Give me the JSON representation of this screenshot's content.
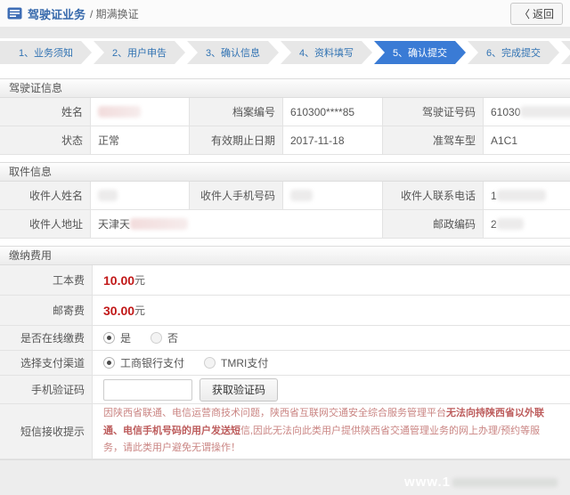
{
  "header": {
    "title": "驾驶证业务",
    "subtitle": "/ 期满换证",
    "back_chevron": "〈",
    "back_label": "返回"
  },
  "steps": [
    {
      "label": "1、业务须知",
      "active": false
    },
    {
      "label": "2、用户申告",
      "active": false
    },
    {
      "label": "3、确认信息",
      "active": false
    },
    {
      "label": "4、资料填写",
      "active": false
    },
    {
      "label": "5、确认提交",
      "active": true
    },
    {
      "label": "6、完成提交",
      "active": false
    }
  ],
  "license": {
    "title": "驾驶证信息",
    "name_label": "姓名",
    "file_no_label": "档案编号",
    "file_no_value": "610300****85",
    "license_no_label": "驾驶证号码",
    "license_no_value": "61030",
    "license_no_cut": "(",
    "status_label": "状态",
    "status_value": "正常",
    "expiry_label": "有效期止日期",
    "expiry_value": "2017-11-18",
    "vehicle_label": "准驾车型",
    "vehicle_value": "A1C1"
  },
  "pickup": {
    "title": "取件信息",
    "recipient_name_label": "收件人姓名",
    "recipient_mobile_label": "收件人手机号码",
    "recipient_phone_label": "收件人联系电话",
    "recipient_phone_value": "1",
    "address_label": "收件人地址",
    "address_value": "天津天",
    "postcode_label": "邮政编码",
    "postcode_value": "2"
  },
  "fees": {
    "title": "缴纳费用",
    "production_fee_label": "工本费",
    "production_fee_value": "10.00",
    "mailing_fee_label": "邮寄费",
    "mailing_fee_value": "30.00",
    "currency_unit": "元",
    "online_pay_label": "是否在线缴费",
    "online_pay_yes": "是",
    "online_pay_no": "否",
    "online_pay_selected": "是",
    "channel_label": "选择支付渠道",
    "channel_icbc": "工商银行支付",
    "channel_tmri": "TMRI支付",
    "channel_selected": "工商银行支付",
    "captcha_label": "手机验证码",
    "captcha_input_value": "",
    "captcha_button_label": "获取验证码",
    "sms_label": "短信接收提示",
    "sms_hint_part1": "因陕西省联通、电信运营商技术问题，陕西省互联网交通安全综合服务管理平台",
    "sms_hint_part2": "无法向持陕西省以外联通、电信手机号码的用户发送短",
    "sms_hint_part3": "信,因此无法向此类用户提供陕西省交通管理业务的网上办理/预约等服务，请此类用户避免无谓操作！"
  },
  "watermark": "www.1",
  "colors": {
    "accent_blue": "#3a7bd5",
    "title_blue": "#3568ab",
    "step_text_blue": "#3173b3",
    "fee_red": "#c11818",
    "hint_red": "#ca8583",
    "label_bg": "#f2f2f2"
  }
}
